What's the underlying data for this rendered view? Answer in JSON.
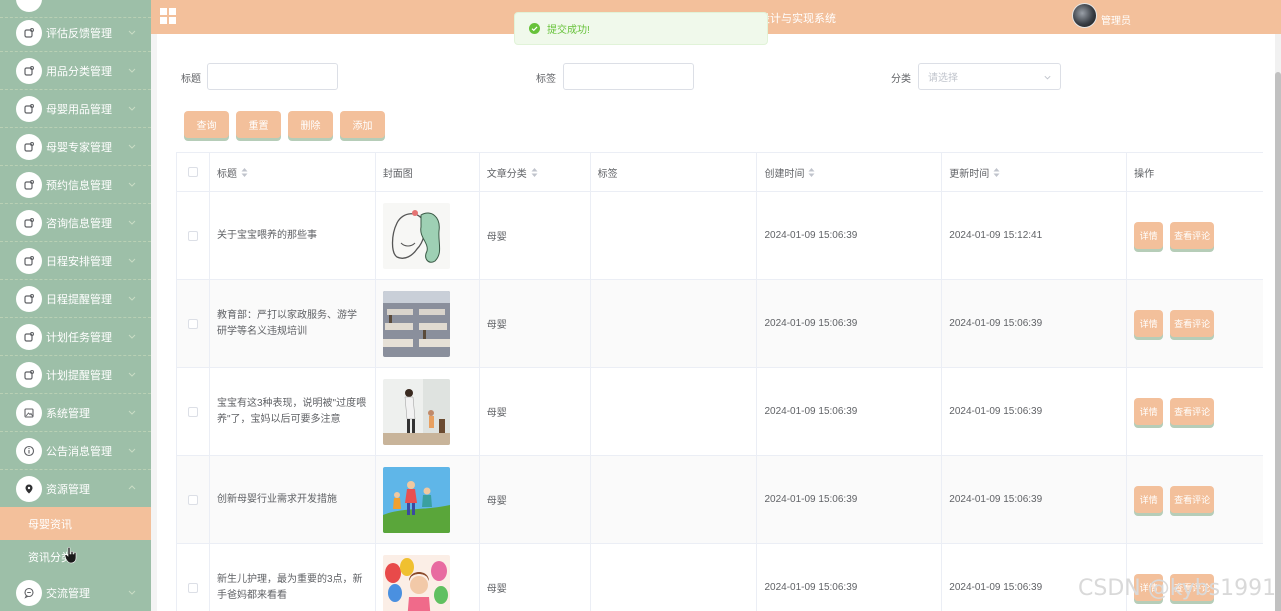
{
  "header": {
    "title": "基于HTML的母婴网站的设计与实现系统",
    "user_name": "管理员"
  },
  "toast": {
    "message": "提交成功!"
  },
  "sidebar": {
    "items": [
      {
        "label": "评估反馈管理"
      },
      {
        "label": "用品分类管理"
      },
      {
        "label": "母婴用品管理"
      },
      {
        "label": "母婴专家管理"
      },
      {
        "label": "预约信息管理"
      },
      {
        "label": "咨询信息管理"
      },
      {
        "label": "日程安排管理"
      },
      {
        "label": "日程提醒管理"
      },
      {
        "label": "计划任务管理"
      },
      {
        "label": "计划提醒管理"
      },
      {
        "label": "系统管理"
      },
      {
        "label": "公告消息管理"
      },
      {
        "label": "资源管理"
      },
      {
        "label": "交流管理"
      }
    ],
    "submenu": [
      {
        "label": "母婴资讯",
        "active": true
      },
      {
        "label": "资讯分类",
        "active": false
      }
    ]
  },
  "search": {
    "title_label": "标题",
    "tag_label": "标签",
    "category_label": "分类",
    "category_placeholder": "请选择"
  },
  "toolbar": {
    "query": "查询",
    "reset": "重置",
    "delete": "删除",
    "add": "添加"
  },
  "table": {
    "headers": {
      "title": "标题",
      "cover": "封面图",
      "category": "文章分类",
      "tags": "标签",
      "created": "创建时间",
      "updated": "更新时间",
      "actions": "操作"
    },
    "rows": [
      {
        "title": "关于宝宝喂养的那些事",
        "category": "母婴",
        "tags": "",
        "created": "2024-01-09 15:06:39",
        "updated": "2024-01-09 15:12:41",
        "detail": "详情",
        "comments": "查看评论"
      },
      {
        "title": "教育部：严打以家政服务、游学研学等名义违规培训",
        "category": "母婴",
        "tags": "",
        "created": "2024-01-09 15:06:39",
        "updated": "2024-01-09 15:06:39",
        "detail": "详情",
        "comments": "查看评论"
      },
      {
        "title": "宝宝有这3种表现，说明被\"过度喂养\"了，宝妈以后可要多注意",
        "category": "母婴",
        "tags": "",
        "created": "2024-01-09 15:06:39",
        "updated": "2024-01-09 15:06:39",
        "detail": "详情",
        "comments": "查看评论"
      },
      {
        "title": "创新母婴行业需求开发措施",
        "category": "母婴",
        "tags": "",
        "created": "2024-01-09 15:06:39",
        "updated": "2024-01-09 15:06:39",
        "detail": "详情",
        "comments": "查看评论"
      },
      {
        "title": "新生儿护理，最为重要的3点，新手爸妈都来看看",
        "category": "母婴",
        "tags": "",
        "created": "2024-01-09 15:06:39",
        "updated": "2024-01-09 15:06:39",
        "detail": "详情",
        "comments": "查看评论"
      }
    ]
  },
  "watermark": "CSDN @kybs1991",
  "colors": {
    "sidebar_bg": "#9dbfa8",
    "accent": "#f3c09b",
    "success": "#67c23a"
  }
}
